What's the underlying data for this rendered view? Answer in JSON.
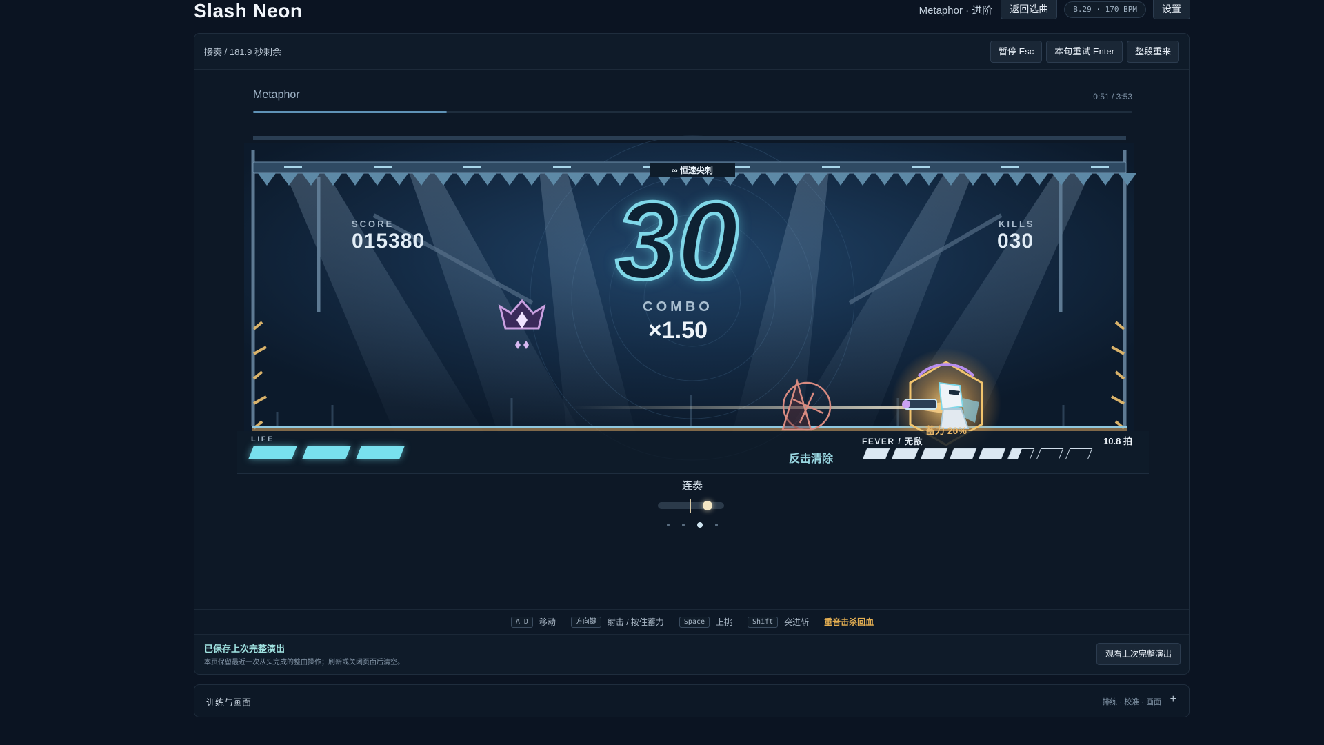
{
  "app": {
    "title": "Slash Neon"
  },
  "header": {
    "song_mode": "Metaphor · 进阶",
    "back_label": "返回选曲",
    "bpm_info": "B.29 · 170 BPM",
    "settings_label": "设置"
  },
  "status": {
    "text": "接奏 / 181.9 秒剩余",
    "pause_label": "暂停 Esc",
    "retry_label": "本句重试 Enter",
    "restart_label": "整段重来"
  },
  "track": {
    "name": "Metaphor",
    "time": "0:51 / 3:53",
    "progress": 0.22
  },
  "hud": {
    "hazard_label": "∞ 恒速尖刺",
    "score_label": "SCORE",
    "score": "015380",
    "kills_label": "KILLS",
    "kills": "030",
    "combo": "30",
    "combo_label": "COMBO",
    "multiplier": "×1.50",
    "counter_clear": "反击清除",
    "charge": "蓄力 20%",
    "life_label": "LIFE",
    "life": 3,
    "fever_label": "FEVER / 无敌",
    "fever_beats": "10.8 拍",
    "fever_cells": 8,
    "fever_level": 5.5
  },
  "mode": {
    "label": "连奏",
    "slider_value": 0.6,
    "page_dots": 4,
    "active_dot": 3
  },
  "controls": [
    {
      "key": "A D",
      "action": "移动"
    },
    {
      "key": "方向键",
      "action": "射击 / 按住蓄力"
    },
    {
      "key": "Space",
      "action": "上挑"
    },
    {
      "key": "Shift",
      "action": "突进斩"
    }
  ],
  "controls_hint": "重音击杀回血",
  "saved": {
    "title": "已保存上次完整演出",
    "subtitle": "本页保留最近一次从头完成的整曲操作；刷新或关闭页面后清空。",
    "watch_label": "观看上次完整演出"
  },
  "training": {
    "label": "训练与画面",
    "sub": "排练 · 校准 · 画面",
    "toggle": "+"
  },
  "colors": {
    "background": "#0b1422",
    "neon_cyan": "#7fd7e8",
    "fever_gold": "#e3ae52",
    "enemy_pink": "#c9a0e0"
  }
}
